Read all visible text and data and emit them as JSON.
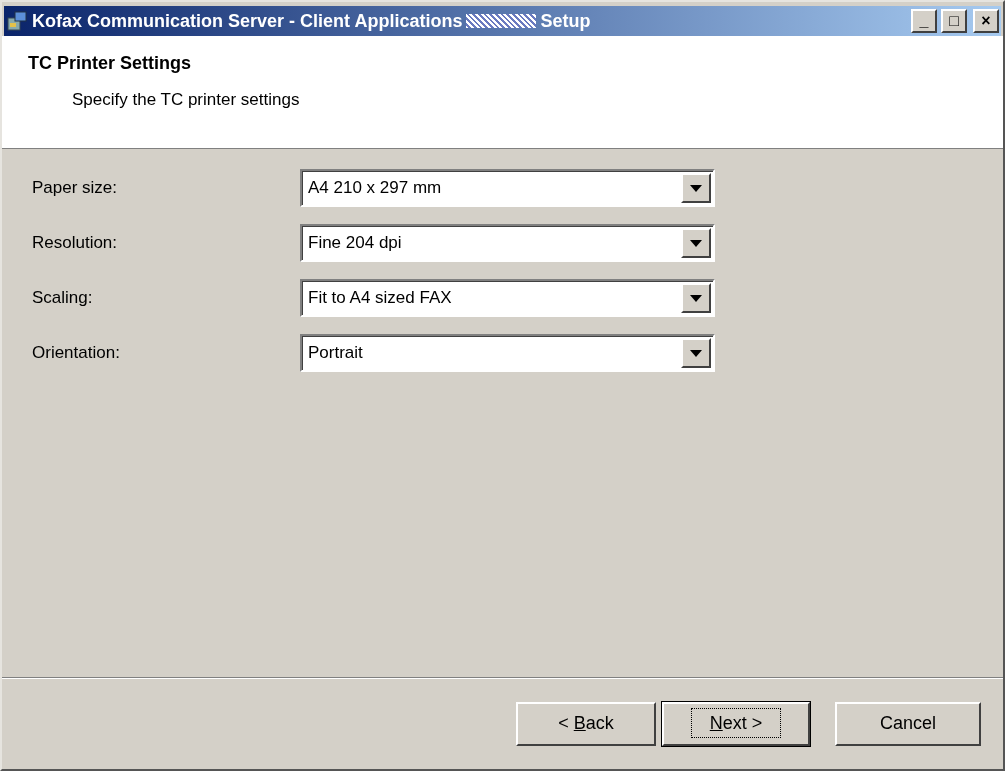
{
  "window": {
    "title_parts": [
      "Kofax Communication Server - Client Applications",
      "Setup"
    ],
    "controls": [
      "_",
      "□",
      "×"
    ]
  },
  "header": {
    "title": "TC Printer Settings",
    "subtitle": "Specify the TC printer settings"
  },
  "fields": [
    {
      "label": "Paper size:",
      "value": "A4 210 x 297 mm"
    },
    {
      "label": "Resolution:",
      "value": "Fine 204 dpi"
    },
    {
      "label": "Scaling:",
      "value": "Fit to A4 sized FAX"
    },
    {
      "label": "Orientation:",
      "value": "Portrait"
    }
  ],
  "buttons": [
    {
      "before": "< ",
      "key": "B",
      "after": "ack",
      "default": false
    },
    {
      "key": "N",
      "after": "ext >",
      "default": true
    },
    {
      "before": "Cancel",
      "default": false
    }
  ]
}
